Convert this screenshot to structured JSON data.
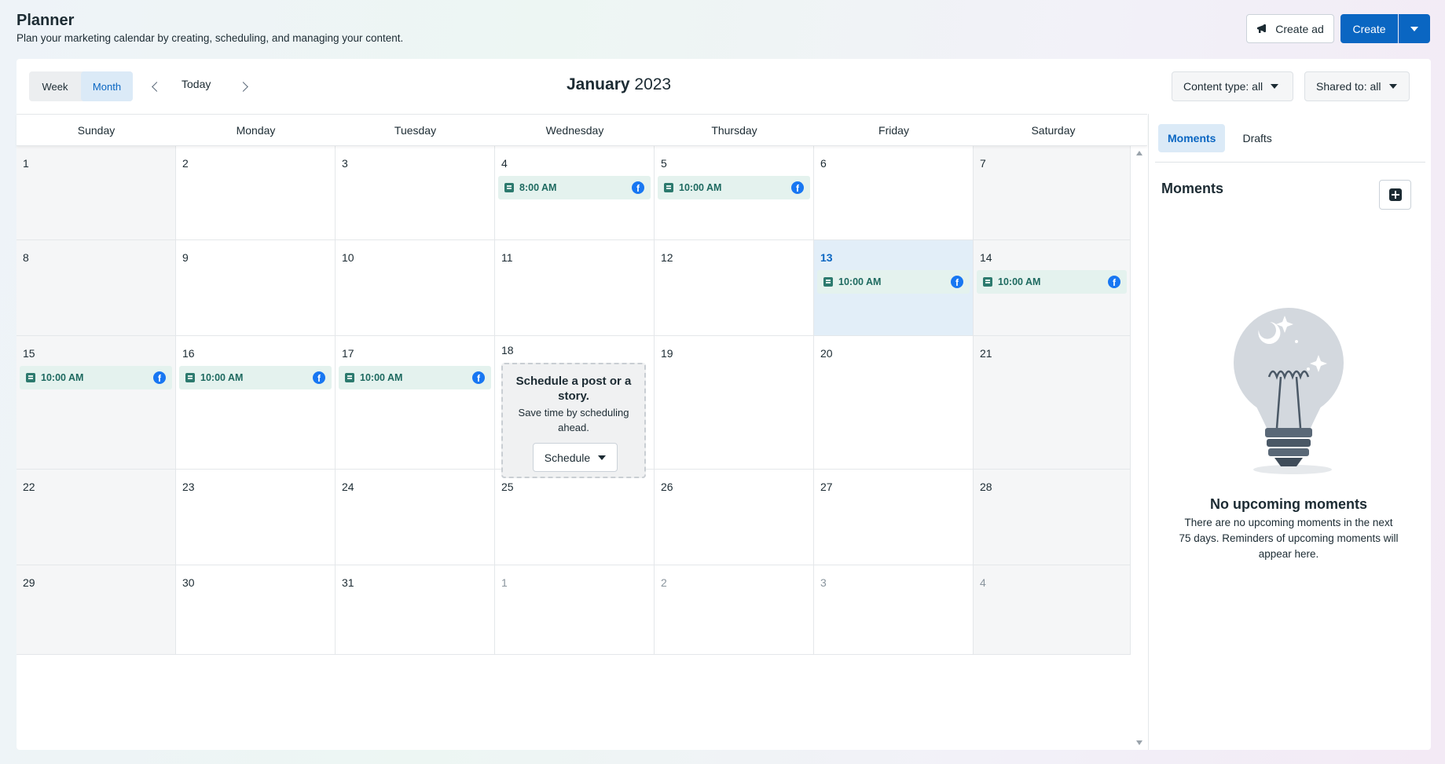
{
  "header": {
    "title": "Planner",
    "subtitle": "Plan your marketing calendar by creating, scheduling, and managing your content.",
    "create_ad_label": "Create ad",
    "create_label": "Create"
  },
  "toolbar": {
    "view_week": "Week",
    "view_month": "Month",
    "today_label": "Today",
    "month": "January",
    "year": "2023",
    "content_type_filter": "Content type: all",
    "shared_to_filter": "Shared to: all"
  },
  "weekdays": [
    "Sunday",
    "Monday",
    "Tuesday",
    "Wednesday",
    "Thursday",
    "Friday",
    "Saturday"
  ],
  "weeks": [
    [
      {
        "day": "1",
        "weekend": true
      },
      {
        "day": "2"
      },
      {
        "day": "3"
      },
      {
        "day": "4",
        "event": "8:00 AM"
      },
      {
        "day": "5",
        "event": "10:00 AM"
      },
      {
        "day": "6"
      },
      {
        "day": "7",
        "weekend": true
      }
    ],
    [
      {
        "day": "8",
        "weekend": true
      },
      {
        "day": "9"
      },
      {
        "day": "10"
      },
      {
        "day": "11"
      },
      {
        "day": "12"
      },
      {
        "day": "13",
        "today": true,
        "event": "10:00 AM"
      },
      {
        "day": "14",
        "weekend": true,
        "event": "10:00 AM"
      }
    ],
    [
      {
        "day": "15",
        "weekend": true,
        "event": "10:00 AM"
      },
      {
        "day": "16",
        "event": "10:00 AM"
      },
      {
        "day": "17",
        "event": "10:00 AM"
      },
      {
        "day": "18",
        "promo": true
      },
      {
        "day": "19"
      },
      {
        "day": "20"
      },
      {
        "day": "21",
        "weekend": true
      }
    ],
    [
      {
        "day": "22",
        "weekend": true
      },
      {
        "day": "23"
      },
      {
        "day": "24"
      },
      {
        "day": "25"
      },
      {
        "day": "26"
      },
      {
        "day": "27"
      },
      {
        "day": "28",
        "weekend": true
      }
    ],
    [
      {
        "day": "29",
        "weekend": true
      },
      {
        "day": "30"
      },
      {
        "day": "31"
      },
      {
        "day": "1",
        "muted": true
      },
      {
        "day": "2",
        "muted": true
      },
      {
        "day": "3",
        "muted": true
      },
      {
        "day": "4",
        "muted": true,
        "weekend": true
      }
    ]
  ],
  "promo": {
    "title": "Schedule a post or a story.",
    "subtitle": "Save time by scheduling ahead.",
    "button": "Schedule"
  },
  "panel": {
    "tab_moments": "Moments",
    "tab_drafts": "Drafts",
    "heading": "Moments",
    "empty_title": "No upcoming moments",
    "empty_text": "There are no upcoming moments in the next 75 days. Reminders of upcoming moments will appear here."
  },
  "icons": {
    "fb": "facebook-icon",
    "post": "post-icon",
    "megaphone": "megaphone-icon"
  },
  "colors": {
    "accent": "#0a66c2",
    "event_bg": "#e4f2ee",
    "event_text": "#1e6a60",
    "today_bg": "#e2eef8"
  }
}
